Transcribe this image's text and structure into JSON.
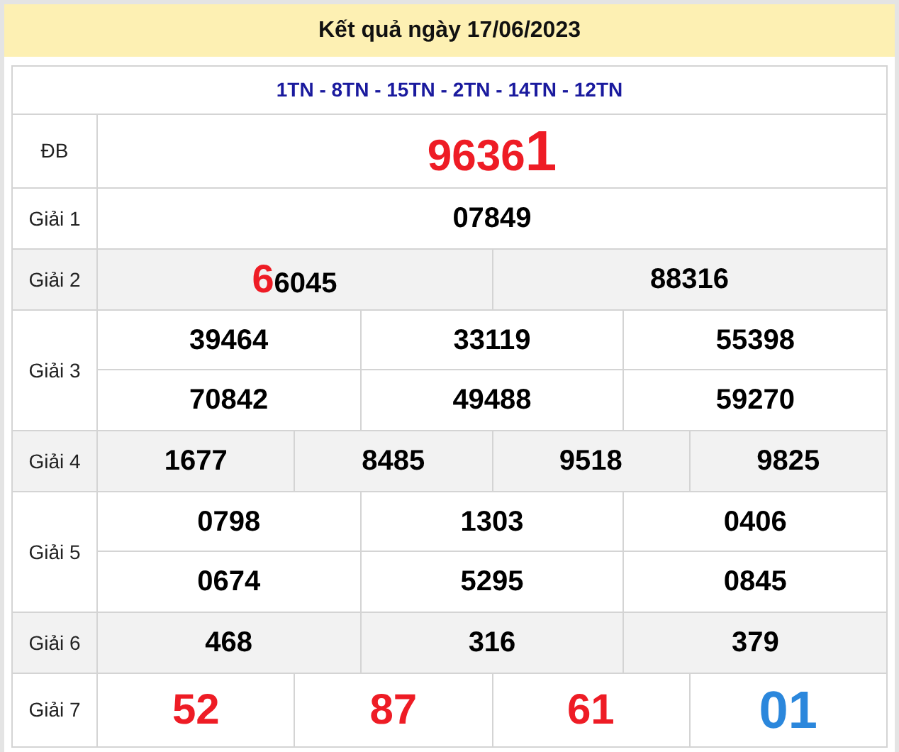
{
  "title": "Kết quả ngày 17/06/2023",
  "codes": "1TN - 8TN - 15TN - 2TN - 14TN - 12TN",
  "prizes": [
    {
      "label": "ĐB",
      "lines": [
        [
          {
            "parts": [
              {
                "text": "9636",
                "kind": "red"
              },
              {
                "text": "1",
                "kind": "red-big"
              }
            ]
          }
        ]
      ]
    },
    {
      "label": "Giải 1",
      "lines": [
        [
          {
            "parts": [
              {
                "text": "07849",
                "kind": "normal"
              }
            ]
          }
        ]
      ]
    },
    {
      "label": "Giải 2",
      "lines": [
        [
          {
            "parts": [
              {
                "text": "6",
                "kind": "red-lead"
              },
              {
                "text": "6045",
                "kind": "normal"
              }
            ]
          },
          {
            "parts": [
              {
                "text": "88316",
                "kind": "normal"
              }
            ]
          }
        ]
      ]
    },
    {
      "label": "Giải 3",
      "lines": [
        [
          {
            "parts": [
              {
                "text": "39464",
                "kind": "normal"
              }
            ]
          },
          {
            "parts": [
              {
                "text": "33119",
                "kind": "normal"
              }
            ]
          },
          {
            "parts": [
              {
                "text": "55398",
                "kind": "normal"
              }
            ]
          }
        ],
        [
          {
            "parts": [
              {
                "text": "70842",
                "kind": "normal"
              }
            ]
          },
          {
            "parts": [
              {
                "text": "49488",
                "kind": "normal"
              }
            ]
          },
          {
            "parts": [
              {
                "text": "59270",
                "kind": "normal"
              }
            ]
          }
        ]
      ]
    },
    {
      "label": "Giải 4",
      "lines": [
        [
          {
            "parts": [
              {
                "text": "1677",
                "kind": "normal"
              }
            ]
          },
          {
            "parts": [
              {
                "text": "8485",
                "kind": "normal"
              }
            ]
          },
          {
            "parts": [
              {
                "text": "9518",
                "kind": "normal"
              }
            ]
          },
          {
            "parts": [
              {
                "text": "9825",
                "kind": "normal"
              }
            ]
          }
        ]
      ]
    },
    {
      "label": "Giải 5",
      "lines": [
        [
          {
            "parts": [
              {
                "text": "0798",
                "kind": "normal"
              }
            ]
          },
          {
            "parts": [
              {
                "text": "1303",
                "kind": "normal"
              }
            ]
          },
          {
            "parts": [
              {
                "text": "0406",
                "kind": "normal"
              }
            ]
          }
        ],
        [
          {
            "parts": [
              {
                "text": "0674",
                "kind": "normal"
              }
            ]
          },
          {
            "parts": [
              {
                "text": "5295",
                "kind": "normal"
              }
            ]
          },
          {
            "parts": [
              {
                "text": "0845",
                "kind": "normal"
              }
            ]
          }
        ]
      ]
    },
    {
      "label": "Giải 6",
      "lines": [
        [
          {
            "parts": [
              {
                "text": "468",
                "kind": "normal"
              }
            ]
          },
          {
            "parts": [
              {
                "text": "316",
                "kind": "normal"
              }
            ]
          },
          {
            "parts": [
              {
                "text": "379",
                "kind": "normal"
              }
            ]
          }
        ]
      ]
    },
    {
      "label": "Giải 7",
      "lines": [
        [
          {
            "parts": [
              {
                "text": "52",
                "kind": "red-large"
              }
            ]
          },
          {
            "parts": [
              {
                "text": "87",
                "kind": "red-large"
              }
            ]
          },
          {
            "parts": [
              {
                "text": "61",
                "kind": "red-large"
              }
            ]
          },
          {
            "parts": [
              {
                "text": "01",
                "kind": "blue-big"
              }
            ]
          }
        ]
      ]
    }
  ]
}
